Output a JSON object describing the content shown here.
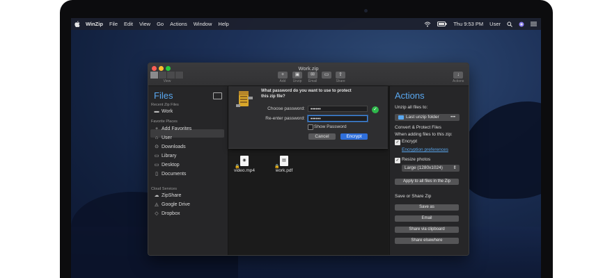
{
  "menubar": {
    "app": "WinZip",
    "items": [
      "File",
      "Edit",
      "View",
      "Go",
      "Actions",
      "Window",
      "Help"
    ],
    "clock": "Thu 9:53 PM",
    "user": "User"
  },
  "window": {
    "title": "Work.zip",
    "toolbar": {
      "view_label": "View",
      "add_label": "Add",
      "unzip_label": "Unzip",
      "email_label": "Email",
      "share_label": "Share",
      "actions_label": "Actions"
    }
  },
  "sidebar": {
    "title": "Files",
    "recent_header": "Recent Zip Files",
    "recent_items": [
      "Work"
    ],
    "favorites_header": "Favorite Places",
    "favorites": [
      "Add Favorites",
      "User",
      "Downloads",
      "Library",
      "Desktop",
      "Documents"
    ],
    "cloud_header": "Cloud Services",
    "cloud": [
      "ZipShare",
      "Google Drive",
      "Dropbox"
    ]
  },
  "dialog": {
    "question": "What password do you want to use to protect this zip file?",
    "choose_label": "Choose password:",
    "choose_value": "••••••",
    "reenter_label": "Re-enter password:",
    "reenter_value": "••••••",
    "show_password": "Show Password",
    "cancel": "Cancel",
    "encrypt": "Encrypt"
  },
  "files": [
    {
      "name": "video.mp4"
    },
    {
      "name": "work.pdf"
    }
  ],
  "actions": {
    "title": "Actions",
    "unzip_all": "Unzip all files to:",
    "unzip_target": "Last unzip folder",
    "convert_header": "Convert & Protect Files",
    "when_adding": "When adding files to this zip:",
    "encrypt": "Encrypt",
    "encryption_prefs": "Encryption preferences",
    "resize": "Resize photos",
    "resize_value": "Large (1280x1024)",
    "apply_all": "Apply to all files in the Zip",
    "save_share_header": "Save or Share Zip",
    "save_as": "Save as",
    "email": "Email",
    "share_clipboard": "Share via clipboard",
    "share_elsewhere": "Share elsewhere"
  }
}
